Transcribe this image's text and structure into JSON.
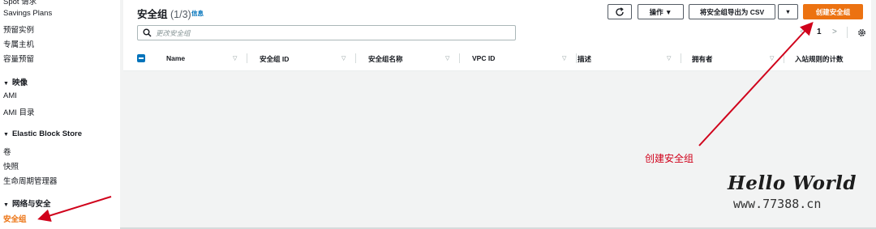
{
  "sidebar": {
    "top_partial": "Spot 请求",
    "items_a": [
      "Savings Plans",
      "预留实例",
      "专属主机",
      "容量预留"
    ],
    "sec_images": "映像",
    "items_images": [
      "AMI",
      "AMI 目录"
    ],
    "sec_ebs": "Elastic Block Store",
    "items_ebs": [
      "卷",
      "快照",
      "生命周期管理器"
    ],
    "sec_network": "网络与安全",
    "active_item": "安全组"
  },
  "header": {
    "title": "安全组",
    "count": "(1/3)",
    "info": "信息"
  },
  "toolbar": {
    "refresh_icon": "refresh-icon",
    "actions_label": "操作 ▼",
    "export_label": "将安全组导出为 CSV",
    "export_dropdown": "▼",
    "create_label": "创建安全组"
  },
  "search": {
    "placeholder": "更改安全组"
  },
  "pagination": {
    "prev": "<",
    "page": "1",
    "next": ">"
  },
  "table": {
    "columns": [
      "Name",
      "安全组 ID",
      "安全组名称",
      "VPC ID",
      "描述",
      "拥有者",
      "入站规则的计数"
    ]
  },
  "annotation": {
    "label": "创建安全组"
  },
  "watermark": {
    "line1": "Hello World",
    "line2": "www.77388.cn"
  },
  "colors": {
    "accent": "#ec7211",
    "link": "#0073bb",
    "annotation": "#d0021b"
  }
}
